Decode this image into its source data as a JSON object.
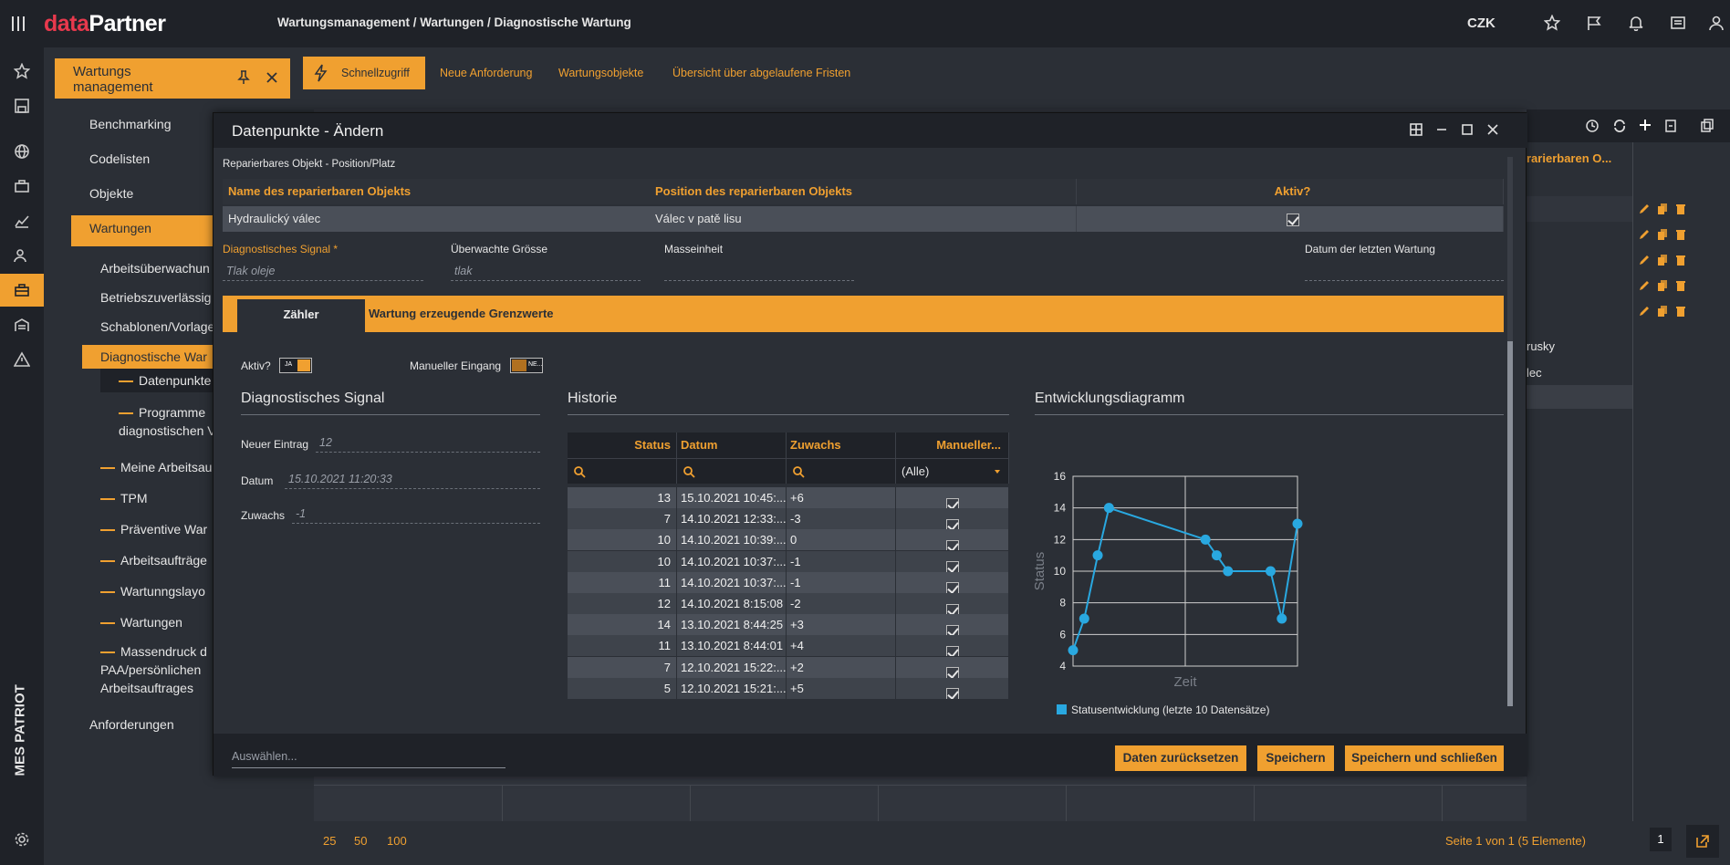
{
  "app": {
    "brand_a": "data",
    "brand_b": "Partner",
    "breadcrumb": "Wartungsmanagement / Wartungen / Diagnostische Wartung",
    "currency": "CZK",
    "vertical_brand": "MES PATRIOT"
  },
  "topbar_icons": [
    "star-icon",
    "flag-icon",
    "bell-icon",
    "list-icon",
    "user-icon"
  ],
  "sidebar": {
    "header": "Wartungs management",
    "items": [
      "Benchmarking",
      "Codelisten",
      "Objekte",
      "Wartungen",
      "Arbeitsüberwachun",
      "Betriebszuverlässig",
      "Schablonen/Vorlage",
      "Diagnostische War",
      "Datenpunkte",
      "Programme",
      "diagnostischen V",
      "Meine Arbeitsau",
      "TPM",
      "Präventive War",
      "Arbeitsaufträge",
      "Wartunngslayo",
      "Wartungen",
      "Massendruck d",
      "PAA/persönlichen",
      "Arbeitsauftrages",
      "Anforderungen"
    ]
  },
  "subtabs": [
    "Schnellzugriff",
    "Neue Anforderung",
    "Wartungsobjekte",
    "Übersicht über abgelaufene Fristen"
  ],
  "background": {
    "col_header": "rarierbaren O...",
    "rows": [
      "",
      "rusky",
      "lec",
      "",
      ""
    ],
    "pager": [
      "25",
      "50",
      "100"
    ],
    "page_info": "Seite 1 von 1 (5 Elemente)",
    "page_num": "1"
  },
  "modal": {
    "title": "Datenpunkte - Ändern",
    "subtitle": "Reparierbares Objekt - Position/Platz",
    "obj_table": {
      "headers": [
        "Name des reparierbaren Objekts",
        "Position des reparierbaren Objekts",
        "Aktiv?"
      ],
      "row": [
        "Hydraulický válec",
        "Válec v patě lisu"
      ]
    },
    "fields": {
      "signal_label": "Diagnostisches Signal *",
      "signal_value": "Tlak oleje",
      "watched_label": "Überwachte Grösse",
      "watched_value": "tlak",
      "unit_label": "Masseinheit",
      "unit_value": "",
      "lastdate_label": "Datum der letzten Wartung",
      "lastdate_value": ""
    },
    "tabs": [
      "Zähler",
      "Wartung erzeugende Grenzwerte"
    ],
    "aktiv_label": "Aktiv?",
    "aktiv_toggle": "JA",
    "manual_label": "Manueller Eingang",
    "manual_toggle": "NE...",
    "signal_section": {
      "title": "Diagnostisches Signal",
      "new_entry_label": "Neuer Eintrag",
      "new_entry_value": "12",
      "date_label": "Datum",
      "date_value": "15.10.2021 11:20:33",
      "increment_label": "Zuwachs",
      "increment_value": "-1"
    },
    "history": {
      "title": "Historie",
      "headers": [
        "Status",
        "Datum",
        "Zuwachs",
        "Manueller..."
      ],
      "filter_all": "(Alle)",
      "rows": [
        [
          "13",
          "15.10.2021 10:45:...",
          "+6"
        ],
        [
          "7",
          "14.10.2021 12:33:...",
          "-3"
        ],
        [
          "10",
          "14.10.2021 10:39:...",
          "0"
        ],
        [
          "10",
          "14.10.2021 10:37:...",
          "-1"
        ],
        [
          "11",
          "14.10.2021 10:37:...",
          "-1"
        ],
        [
          "12",
          "14.10.2021 8:15:08",
          "-2"
        ],
        [
          "14",
          "13.10.2021 8:44:25",
          "+3"
        ],
        [
          "11",
          "13.10.2021 8:44:01",
          "+4"
        ],
        [
          "7",
          "12.10.2021 15:22:...",
          "+2"
        ],
        [
          "5",
          "12.10.2021 15:21:...",
          "+5"
        ]
      ]
    },
    "chart_section_title": "Entwicklungsdiagramm",
    "select_placeholder": "Auswählen...",
    "buttons": [
      "Daten zurücksetzen",
      "Speichern",
      "Speichern und schließen"
    ]
  },
  "chart_data": {
    "type": "line",
    "title": "",
    "xlabel": "Zeit",
    "ylabel": "Status",
    "ylim": [
      4,
      16
    ],
    "yticks": [
      "16",
      "14",
      "12",
      "10",
      "8",
      "6",
      "4"
    ],
    "series": [
      {
        "name": "Statusentwicklung (letzte 10 Datensätze)",
        "color": "#29a8e0",
        "x": [
          0,
          0.05,
          0.11,
          0.16,
          0.59,
          0.64,
          0.69,
          0.88,
          0.93,
          1.0
        ],
        "values": [
          5,
          7,
          11,
          14,
          12,
          11,
          10,
          10,
          7,
          13
        ]
      }
    ],
    "grid": true,
    "legend": "bottom-left"
  }
}
